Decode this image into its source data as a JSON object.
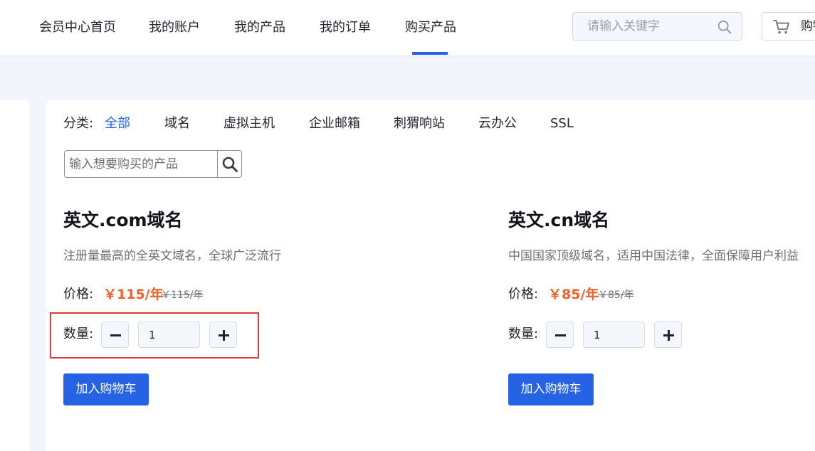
{
  "header": {
    "nav": [
      "会员中心首页",
      "我的账户",
      "我的产品",
      "我的订单",
      "购买产品"
    ],
    "active_nav": "购买产品",
    "search": {
      "placeholder": "请输入关键字",
      "icon": "search-icon"
    },
    "cart": {
      "label": "购物车",
      "icon": "cart-icon"
    }
  },
  "categories": {
    "label": "分类:",
    "items": [
      "全部",
      "域名",
      "虚拟主机",
      "企业邮箱",
      "刺猬响站",
      "云办公",
      "SSL"
    ],
    "active": "全部"
  },
  "product_search": {
    "placeholder": "输入想要购买的产品",
    "icon": "search-icon"
  },
  "products": [
    {
      "name": "英文.com域名",
      "desc": "注册量最高的全英文域名，全球广泛流行",
      "price_label": "价格:",
      "price": "￥115/年",
      "original_price": "￥115/年",
      "qty_label": "数量:",
      "qty": "1",
      "add_label": "加入购物车"
    },
    {
      "name": "英文.cn域名",
      "desc": "中国国家顶级域名，适用中国法律，全面保障用户利益",
      "price_label": "价格:",
      "price": "￥85/年",
      "original_price": "￥85/年",
      "qty_label": "数量:",
      "qty": "1",
      "add_label": "加入购物车"
    }
  ],
  "colors": {
    "accent": "#2563e4",
    "price": "#f0612d",
    "highlight": "#e03a3a",
    "page_bg": "#f2f5fb"
  }
}
